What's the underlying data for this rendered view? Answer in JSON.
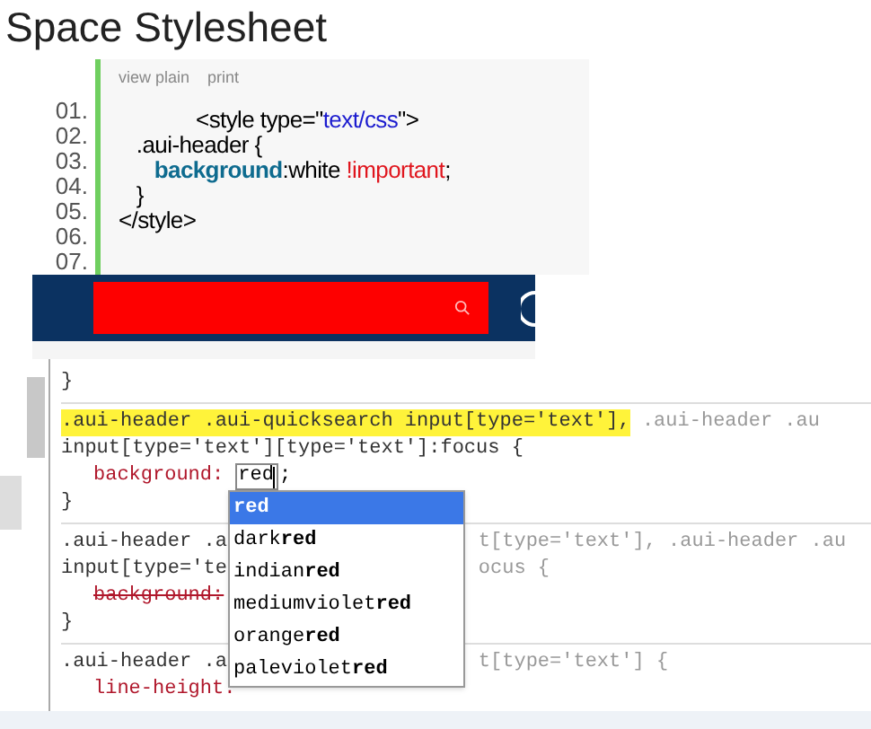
{
  "title": "Space Stylesheet",
  "code_block": {
    "toolbar": [
      "view plain",
      "print"
    ],
    "lines": [
      {
        "number": "01.",
        "tokens": [
          {
            "kind": "plain",
            "text": "             <style type=\""
          },
          {
            "kind": "string",
            "text": "text/css"
          },
          {
            "kind": "plain",
            "text": "\">"
          }
        ]
      },
      {
        "number": "02.",
        "tokens": [
          {
            "kind": "plain",
            "text": "   .aui-header {"
          }
        ]
      },
      {
        "number": "03.",
        "tokens": [
          {
            "kind": "keyword",
            "text": "      background"
          },
          {
            "kind": "plain",
            "text": ":white "
          },
          {
            "kind": "important",
            "text": "!important"
          },
          {
            "kind": "plain",
            "text": ";"
          }
        ]
      },
      {
        "number": "04.",
        "tokens": [
          {
            "kind": "plain",
            "text": "   }"
          }
        ]
      },
      {
        "number": "05.",
        "tokens": [
          {
            "kind": "plain",
            "text": "</style>"
          }
        ]
      },
      {
        "number": "06."
      },
      {
        "number": "07."
      }
    ]
  },
  "devtools": {
    "rules": [
      {
        "lines": [
          {
            "kind": "brace",
            "left": "}"
          }
        ]
      },
      {
        "lines": [
          {
            "kind": "selector",
            "left": ".aui-header .aui-quicksearch input[type='text'],",
            "right": " .aui-header .au",
            "highlighted": true
          },
          {
            "kind": "selector",
            "left": "input[type='text'][type='text']:focus {",
            "highlighted": false
          },
          {
            "kind": "editing",
            "property": "background:",
            "value": "red",
            "after": ";"
          },
          {
            "kind": "brace",
            "left": "}"
          }
        ]
      },
      {
        "lines": [
          {
            "kind": "selector",
            "left": ".aui-header .a",
            "right": "t[type='text'], .aui-header .au",
            "highlighted": false
          },
          {
            "kind": "selector",
            "left": "input[type='te",
            "right": "ocus {",
            "highlighted": false
          },
          {
            "kind": "property",
            "property": "background:",
            "struck": true
          },
          {
            "kind": "brace",
            "left": "}"
          }
        ]
      },
      {
        "lines": [
          {
            "kind": "selector",
            "left": ".aui-header .a",
            "right": "t[type='text'] {",
            "highlighted": false
          },
          {
            "kind": "property",
            "property": "line-height:",
            "struck": false
          }
        ]
      }
    ],
    "suggestions": [
      {
        "label": "**red**",
        "selected": true
      },
      {
        "label": "dark**red**",
        "selected": false
      },
      {
        "label": "indian**red**",
        "selected": false
      },
      {
        "label": "mediumviolet**red**",
        "selected": false
      },
      {
        "label": "orange**red**",
        "selected": false
      },
      {
        "label": "paleviolet**red**",
        "selected": false
      }
    ]
  }
}
